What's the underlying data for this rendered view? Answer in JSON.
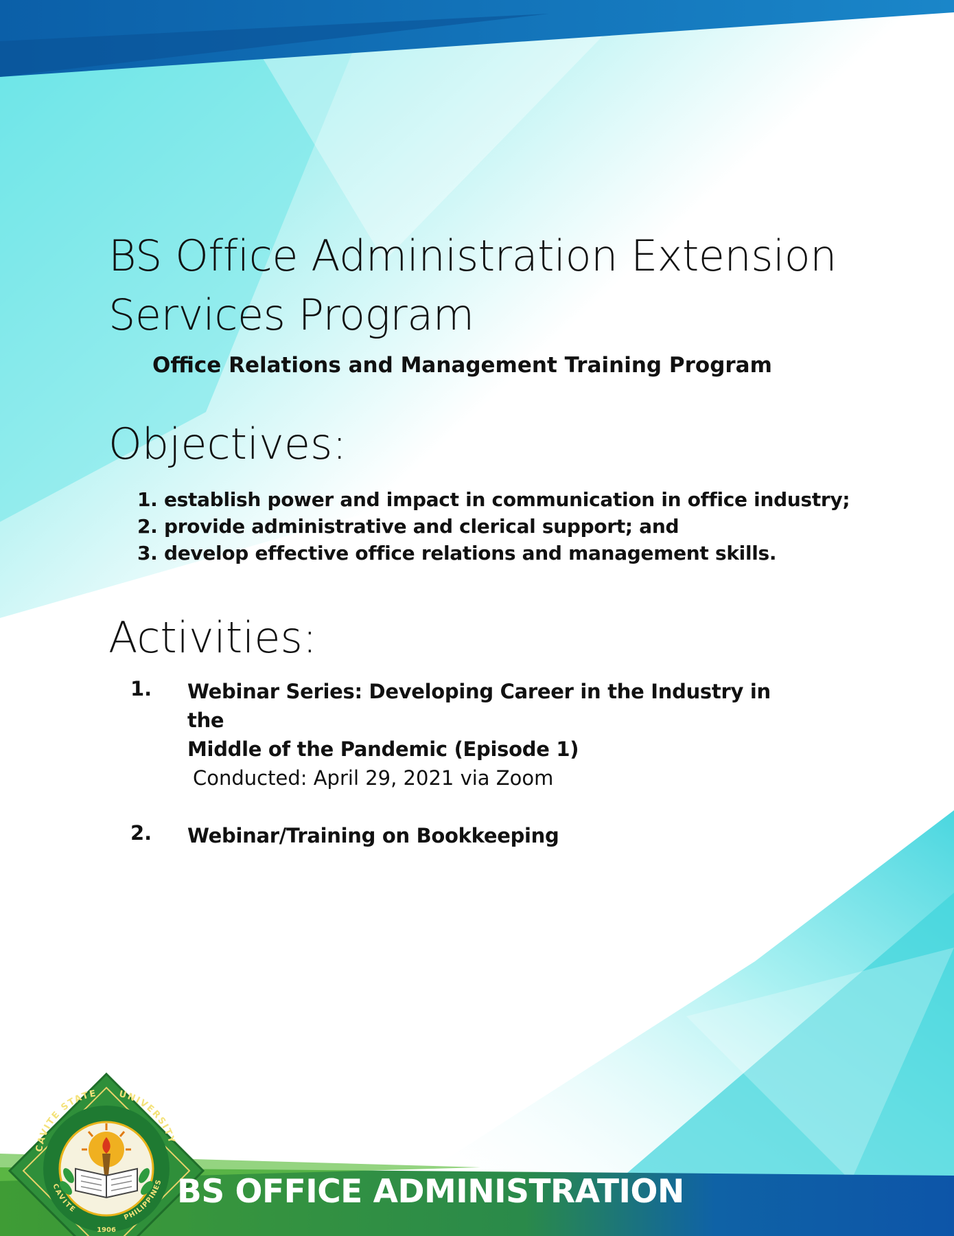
{
  "document": {
    "title": "BS Office Administration Extension Services Program",
    "subtitle": "Office Relations and Management Training Program",
    "objectives_heading": "Objectives:",
    "objectives": [
      "1. establish power and impact in communication in office industry;",
      "2. provide administrative and clerical support; and",
      "3. develop effective office relations and management skills."
    ],
    "activities_heading": "Activities:",
    "activities": [
      {
        "number": "1.",
        "title_line1": "Webinar Series: Developing Career in the Industry in the",
        "title_line2": "Middle of the Pandemic (Episode 1)",
        "conducted": "Conducted: April 29, 2021 via Zoom"
      },
      {
        "number": "2.",
        "title_line1": "Webinar/Training on Bookkeeping"
      }
    ]
  },
  "footer": {
    "label": "BS OFFICE ADMINISTRATION",
    "seal": {
      "arc_top_left": "CAVITE STATE",
      "arc_top_right": "UNIVERSITY",
      "arc_bottom_left": "CAVITE",
      "arc_bottom_right": "PHILIPPINES",
      "year": "1906"
    }
  },
  "colors": {
    "top_band": "#0a6fb8",
    "accent_cyan": "#39d3da",
    "footer_green": "#3f9c35",
    "footer_blue": "#0d55a8",
    "seal_green": "#2f8f3a",
    "seal_gold": "#e8b31a"
  }
}
